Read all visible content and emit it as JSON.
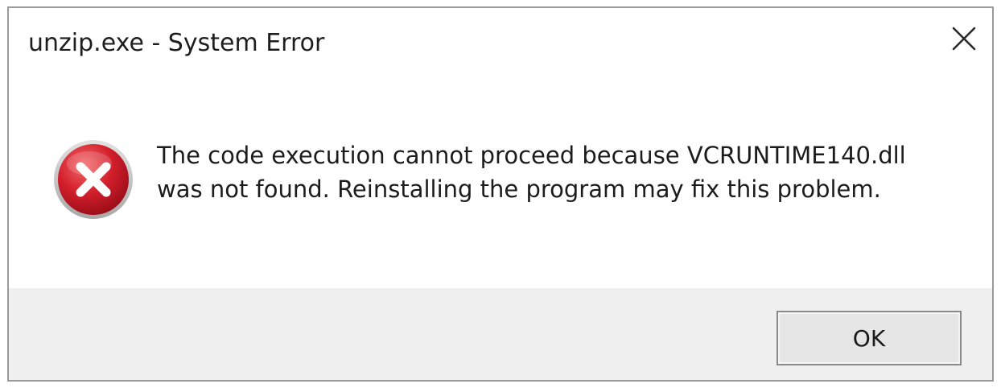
{
  "window": {
    "title": "unzip.exe - System Error"
  },
  "dialog": {
    "icon": "error-icon",
    "message": "The code execution cannot proceed because VCRUNTIME140.dll was not found. Reinstalling the program may fix this problem."
  },
  "buttons": {
    "ok_label": "OK",
    "close_icon": "close-icon"
  },
  "colors": {
    "icon_red": "#c8182a",
    "footer_background": "#efefef",
    "border": "#9a9a9a"
  }
}
